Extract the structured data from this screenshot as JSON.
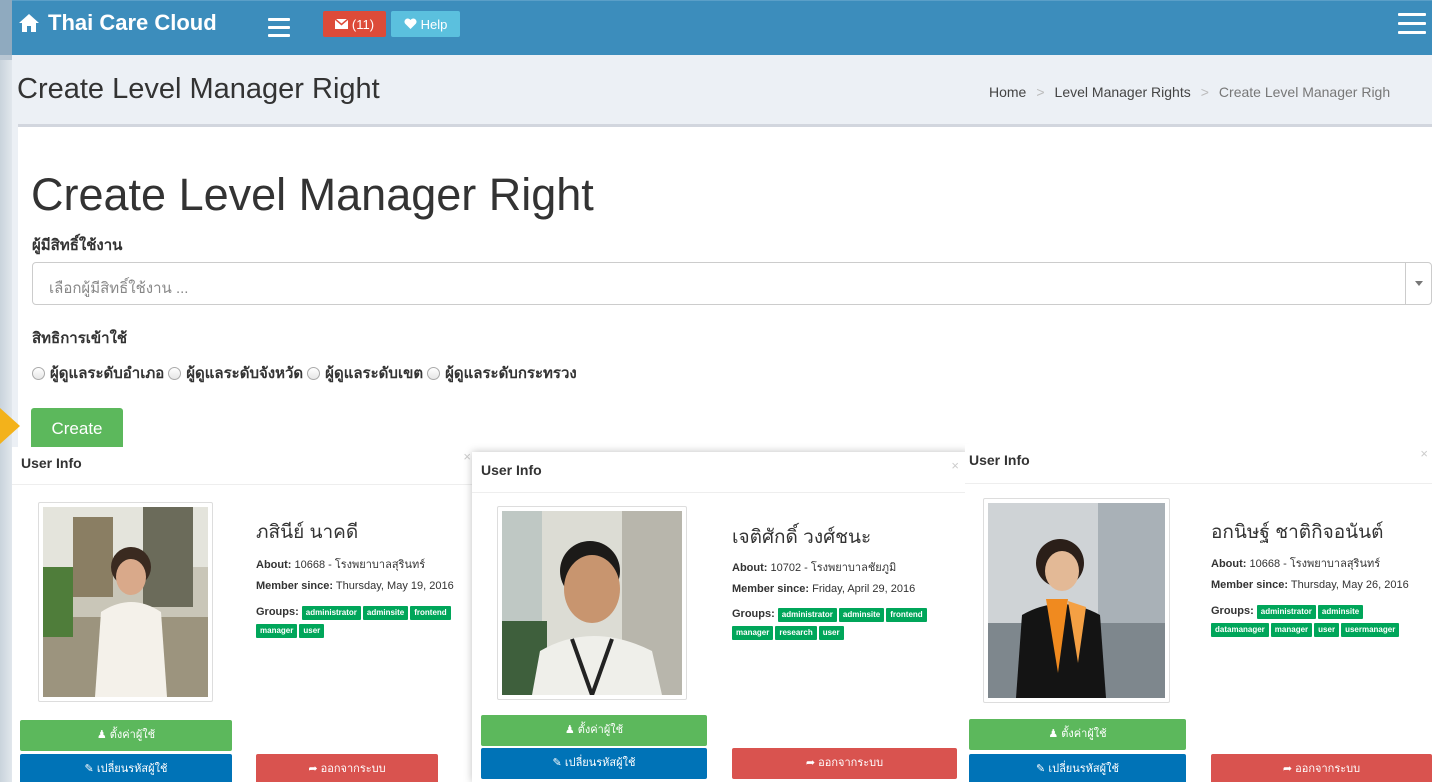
{
  "navbar": {
    "brand": "Thai Care Cloud",
    "mail_count": "(11)",
    "help_label": "Help"
  },
  "header": {
    "title": "Create Level Manager Right",
    "breadcrumb": [
      "Home",
      "Level Manager Rights",
      "Create Level Manager Righ"
    ]
  },
  "form": {
    "heading": "Create Level Manager Right",
    "user_label": "ผู้มีสิทธิ์ใช้งาน",
    "user_placeholder": "เลือกผู้มีสิทธิ์ใช้งาน ...",
    "access_label": "สิทธิการเข้าใช้",
    "radio_options": [
      "ผู้ดูแลระดับอำเภอ",
      "ผู้ดูแลระดับจังหวัด",
      "ผู้ดูแลระดับเขต",
      "ผู้ดูแลระดับกระทรวง"
    ],
    "create_label": "Create"
  },
  "cards": [
    {
      "title": "User Info",
      "close": "×",
      "name": "ภสินีย์ นาคดี",
      "about_label": "About:",
      "about": "10668 - โรงพยาบาลสุรินทร์",
      "since_label": "Member since:",
      "since": "Thursday, May 19, 2016",
      "groups_label": "Groups:",
      "groups": [
        "administrator",
        "adminsite",
        "frontend",
        "manager",
        "user"
      ],
      "settings_label": "ตั้งค่าผู้ใช้",
      "password_label": "เปลี่ยนรหัสผู้ใช้",
      "logout_label": "ออกจากระบบ"
    },
    {
      "title": "User Info",
      "close": "×",
      "name": "เจติศักดิ์ วงศ์ชนะ",
      "about_label": "About:",
      "about": "10702 - โรงพยาบาลชัยภูมิ",
      "since_label": "Member since:",
      "since": "Friday, April 29, 2016",
      "groups_label": "Groups:",
      "groups": [
        "administrator",
        "adminsite",
        "frontend",
        "manager",
        "research",
        "user"
      ],
      "settings_label": "ตั้งค่าผู้ใช้",
      "password_label": "เปลี่ยนรหัสผู้ใช้",
      "logout_label": "ออกจากระบบ"
    },
    {
      "title": "User Info",
      "close": "×",
      "name": "อกนิษฐ์ ชาติกิจอนันต์",
      "about_label": "About:",
      "about": "10668 - โรงพยาบาลสุรินทร์",
      "since_label": "Member since:",
      "since": "Thursday, May 26, 2016",
      "groups_label": "Groups:",
      "groups": [
        "administrator",
        "adminsite",
        "datamanager",
        "manager",
        "user",
        "usermanager"
      ],
      "settings_label": "ตั้งค่าผู้ใช้",
      "password_label": "เปลี่ยนรหัสผู้ใช้",
      "logout_label": "ออกจากระบบ"
    }
  ],
  "colors": {
    "navbar": "#3c8dbc",
    "mail": "#dd4b39",
    "help": "#5bc0de",
    "create": "#5cb85c",
    "badge": "#00a65a",
    "password_btn": "#0073b7",
    "logout_btn": "#d9534f"
  }
}
